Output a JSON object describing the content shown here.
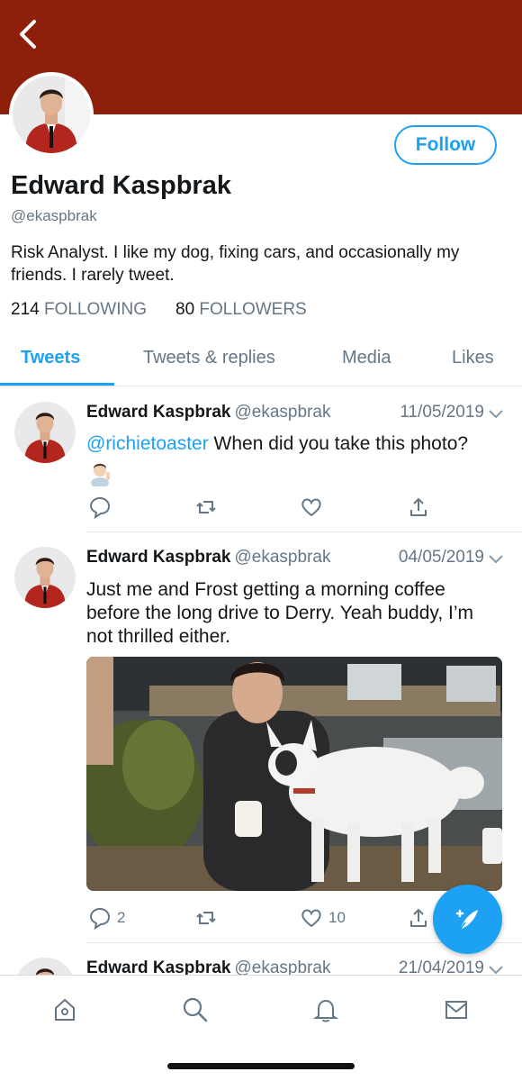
{
  "profile": {
    "display_name": "Edward Kaspbrak",
    "handle": "@ekaspbrak",
    "bio": "Risk Analyst. I like my dog, fixing cars, and occasionally my friends. I rarely tweet.",
    "following_count": "214",
    "following_label": "FOLLOWING",
    "followers_count": "80",
    "followers_label": "FOLLOWERS",
    "follow_label": "Follow"
  },
  "tabs": [
    "Tweets",
    "Tweets & replies",
    "Media",
    "Likes"
  ],
  "tweets": [
    {
      "name": "Edward Kaspbrak",
      "handle": "@ekaspbrak",
      "date": "11/05/2019",
      "mention": "@richietoaster",
      "text": " When did you take this photo?",
      "emoji": "man-raising-hand-emoji",
      "replies": "",
      "retweets": "",
      "likes": ""
    },
    {
      "name": "Edward Kaspbrak",
      "handle": "@ekaspbrak",
      "date": "04/05/2019",
      "text": "Just me and Frost getting a morning coffee before the long drive to Derry. Yeah buddy, I’m not thrilled either.",
      "replies": "2",
      "retweets": "",
      "likes": "10"
    },
    {
      "name": "Edward Kaspbrak",
      "handle": "@ekaspbrak",
      "date": "21/04/2019"
    }
  ],
  "icons": {
    "back": "back-arrow-icon",
    "reply": "reply-icon",
    "retweet": "retweet-icon",
    "like": "heart-icon",
    "share": "share-icon",
    "compose": "compose-tweet-icon",
    "nav": [
      "home-icon",
      "search-icon",
      "notifications-icon",
      "messages-icon"
    ]
  },
  "colors": {
    "banner": "#8e1f0b",
    "accent": "#1da1f2",
    "secondary_text": "#657786"
  }
}
